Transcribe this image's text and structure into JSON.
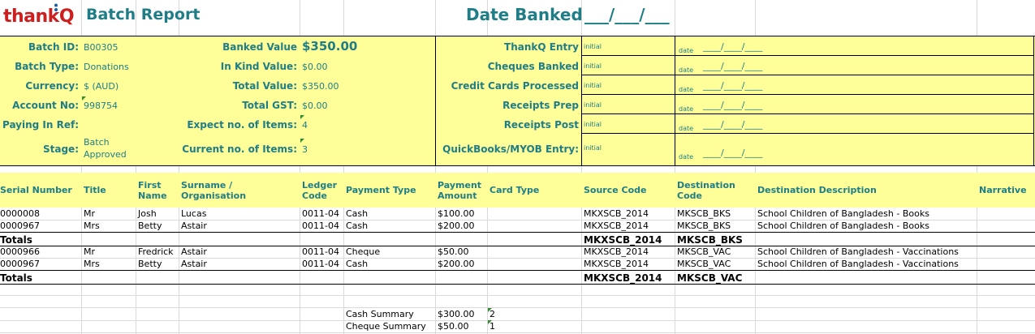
{
  "logo": {
    "text": "thankQ"
  },
  "header": {
    "title": "Batch Report",
    "date_banked_label": "Date Banked",
    "date_banked_blank": "___/___/___"
  },
  "batch": {
    "batch_id_label": "Batch ID:",
    "batch_id": "B00305",
    "batch_type_label": "Batch Type:",
    "batch_type": "Donations",
    "currency_label": "Currency:",
    "currency": "$ (AUD)",
    "account_no_label": "Account No:",
    "account_no": "998754",
    "paying_in_ref_label": "Paying In Ref:",
    "stage_label": "Stage:",
    "stage_line1": "Batch",
    "stage_line2": "Approved"
  },
  "values": {
    "banked_value_label": "Banked Value",
    "banked_value": "$350.00",
    "in_kind_label": "In Kind Value:",
    "in_kind": "$0.00",
    "total_value_label": "Total Value:",
    "total_value": "$350.00",
    "total_gst_label": "Total GST:",
    "total_gst": "$0.00",
    "expect_items_label": "Expect no. of Items:",
    "expect_items": "4",
    "current_items_label": "Current no. of Items:",
    "current_items": "3"
  },
  "checklist": {
    "initial_label": "initial",
    "date_label": "date",
    "date_blank": "____/____/____",
    "items": [
      "ThankQ Entry",
      "Cheques Banked",
      "Credit Cards Processed",
      "Receipts Prep",
      "Receipts Post",
      "QuickBooks/MYOB Entry:"
    ]
  },
  "columns": {
    "serial": "Serial Number",
    "title": "Title",
    "first1": "First",
    "first2": "Name",
    "surname1": "Surname /",
    "surname2": "Organisation",
    "ledger1": "Ledger",
    "ledger2": "Code",
    "ptype": "Payment Type",
    "pamt1": "Payment",
    "pamt2": "Amount",
    "card": "Card Type",
    "source": "Source Code",
    "dest1": "Destination",
    "dest2": "Code",
    "destdesc": "Destination Description",
    "narrative": "Narrative"
  },
  "rows": [
    {
      "serial": "0000008",
      "title": "Mr",
      "first": "Josh",
      "surname": "Lucas",
      "ledger": "0011-04",
      "ptype": "Cash",
      "amount": "$100.00",
      "source": "MKXSCB_2014",
      "dest": "MKSCB_BKS",
      "desc": "School Children of Bangladesh - Books"
    },
    {
      "serial": "0000967",
      "title": "Mrs",
      "first": "Betty",
      "surname": "Astair",
      "ledger": "0011-04",
      "ptype": "Cash",
      "amount": "$200.00",
      "source": "MKXSCB_2014",
      "dest": "MKSCB_BKS",
      "desc": "School Children of Bangladesh - Books"
    },
    {
      "serial": "0000966",
      "title": "Mr",
      "first": "Fredrick",
      "surname": "Astair",
      "ledger": "0011-04",
      "ptype": "Cheque",
      "amount": "$50.00",
      "source": "MKXSCB_2014",
      "dest": "MKSCB_VAC",
      "desc": "School Children of Bangladesh - Vaccinations"
    },
    {
      "serial": "0000967",
      "title": "Mrs",
      "first": "Betty",
      "surname": "Astair",
      "ledger": "0011-04",
      "ptype": "Cash",
      "amount": "$200.00",
      "source": "MKXSCB_2014",
      "dest": "MKSCB_VAC",
      "desc": "School Children of Bangladesh - Vaccinations"
    }
  ],
  "totals": [
    {
      "label": "Totals",
      "source": "MKXSCB_2014",
      "dest": "MKSCB_BKS"
    },
    {
      "label": "Totals",
      "source": "MKXSCB_2014",
      "dest": "MKSCB_VAC"
    }
  ],
  "summary": {
    "cash_label": "Cash Summary",
    "cash_amount": "$300.00",
    "cash_count": "2",
    "cheque_label": "Cheque Summary",
    "cheque_amount": "$50.00",
    "cheque_count": "1"
  },
  "colors": {
    "teal": "#1f7d86",
    "yellow": "#ffff99",
    "logo_red": "#cc1f1f"
  }
}
